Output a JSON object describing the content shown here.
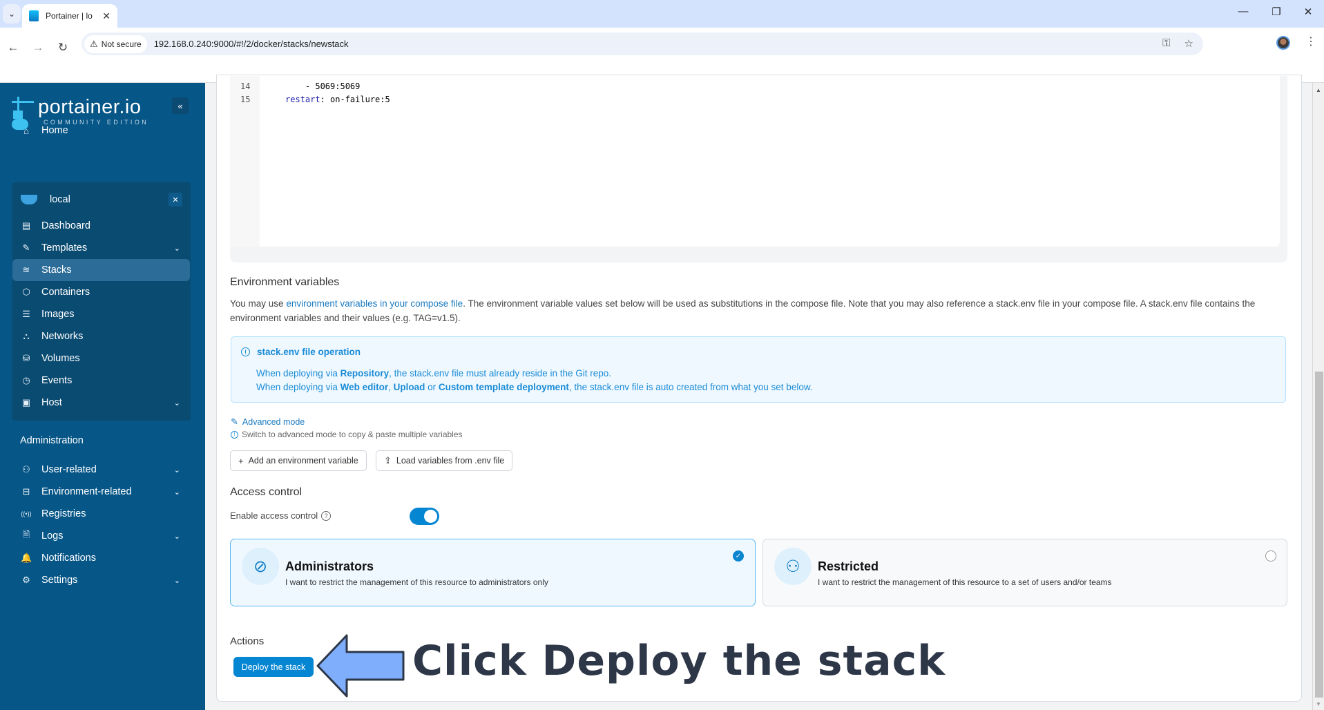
{
  "browser": {
    "tab_title": "Portainer | lo",
    "tab_close": "✕",
    "tab_menu_icon": "⌄",
    "security_label": "Not secure",
    "url": "192.168.0.240:9000/#!/2/docker/stacks/newstack",
    "back": "←",
    "forward": "→",
    "reload": "↻",
    "key_icon": "⚿",
    "star_icon": "☆",
    "menu_icon": "⋮",
    "minimize": "—",
    "restore": "❐",
    "close": "✕"
  },
  "sidebar": {
    "brand": "portainer.io",
    "edition": "COMMUNITY EDITION",
    "collapse_icon": "«",
    "home": {
      "label": "Home",
      "icon": "⌂"
    },
    "environment": {
      "name": "local",
      "close_icon": "✕",
      "items": [
        {
          "label": "Dashboard",
          "icon": "▤",
          "chevron": ""
        },
        {
          "label": "Templates",
          "icon": "✎",
          "chevron": "⌄"
        },
        {
          "label": "Stacks",
          "icon": "≋",
          "chevron": "",
          "active": true
        },
        {
          "label": "Containers",
          "icon": "⬡",
          "chevron": ""
        },
        {
          "label": "Images",
          "icon": "☰",
          "chevron": ""
        },
        {
          "label": "Networks",
          "icon": "⛬",
          "chevron": ""
        },
        {
          "label": "Volumes",
          "icon": "⛁",
          "chevron": ""
        },
        {
          "label": "Events",
          "icon": "◷",
          "chevron": ""
        },
        {
          "label": "Host",
          "icon": "▣",
          "chevron": "⌄"
        }
      ]
    },
    "admin_heading": "Administration",
    "admin_items": [
      {
        "label": "User-related",
        "icon": "⚇",
        "chevron": "⌄"
      },
      {
        "label": "Environment-related",
        "icon": "⊟",
        "chevron": "⌄"
      },
      {
        "label": "Registries",
        "icon": "((•))",
        "chevron": ""
      },
      {
        "label": "Logs",
        "icon": "🗎",
        "chevron": "⌄"
      },
      {
        "label": "Notifications",
        "icon": "🔔",
        "chevron": ""
      },
      {
        "label": "Settings",
        "icon": "⚙",
        "chevron": "⌄"
      }
    ]
  },
  "editor": {
    "lines": [
      {
        "number": "14",
        "text": "    - 5069:5069"
      },
      {
        "number": "15",
        "key": "restart",
        "value": ": on-failure:5"
      }
    ]
  },
  "env_vars": {
    "title": "Environment variables",
    "intro_pre": "You may use ",
    "intro_link": "environment variables in your compose file",
    "intro_post": ". The environment variable values set below will be used as substitutions in the compose file. Note that you may also reference a stack.env file in your compose file. A stack.env file contains the environment variables and their values (e.g. TAG=v1.5).",
    "info": {
      "icon": "!",
      "title": "stack.env file operation",
      "line1_pre": "When deploying via ",
      "line1_bold": "Repository",
      "line1_post": ", the stack.env file must already reside in the Git repo.",
      "line2_pre": "When deploying via ",
      "line2_bold1": "Web editor",
      "line2_sep1": ", ",
      "line2_bold2": "Upload",
      "line2_sep2": " or ",
      "line2_bold3": "Custom template deployment",
      "line2_post": ", the stack.env file is auto created from what you set below."
    },
    "advanced_mode": "Advanced mode",
    "advanced_icon": "✎",
    "advanced_hint": "Switch to advanced mode to copy & paste multiple variables",
    "add_button": "Add an environment variable",
    "add_icon": "+",
    "load_button": "Load variables from .env file",
    "load_icon": "⇪"
  },
  "access_control": {
    "title": "Access control",
    "toggle_label": "Enable access control",
    "help_icon": "?",
    "enabled": true,
    "options": [
      {
        "title": "Administrators",
        "description": "I want to restrict the management of this resource to administrators only",
        "icon": "⊘",
        "selected": true,
        "check": "✓"
      },
      {
        "title": "Restricted",
        "description": "I want to restrict the management of this resource to a set of users and/or teams",
        "icon": "⚇",
        "selected": false
      }
    ]
  },
  "actions": {
    "title": "Actions",
    "deploy_button": "Deploy the stack"
  },
  "annotation": {
    "text": "Click Deploy the stack",
    "arrow_color": "#7eaefc"
  },
  "scrollbar": {
    "up": "▲",
    "down": "▼"
  }
}
